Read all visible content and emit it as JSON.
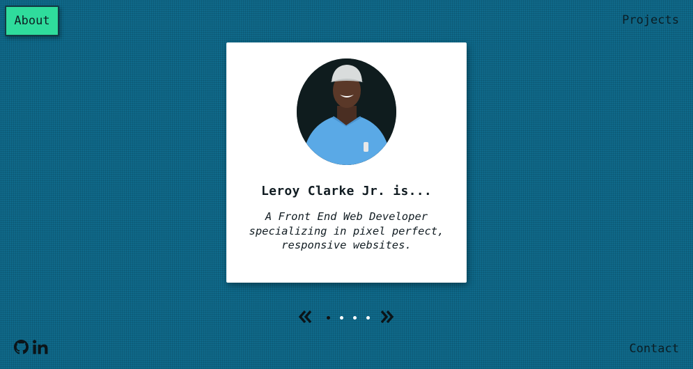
{
  "nav": {
    "about_label": "About",
    "projects_label": "Projects",
    "contact_label": "Contact"
  },
  "card": {
    "name": "Leroy Clarke Jr. is...",
    "description_lines": [
      "A Front End Web Developer",
      "specializing in pixel perfect,",
      "responsive websites."
    ]
  },
  "carousel": {
    "slide_count": 4,
    "active_index": 0
  },
  "social": {
    "icons": [
      "github-icon",
      "linkedin-icon"
    ]
  },
  "colors": {
    "background": "#0f6a8b",
    "about_button": "#2fdc9c",
    "card": "#ffffff",
    "text": "#0b1d24"
  }
}
